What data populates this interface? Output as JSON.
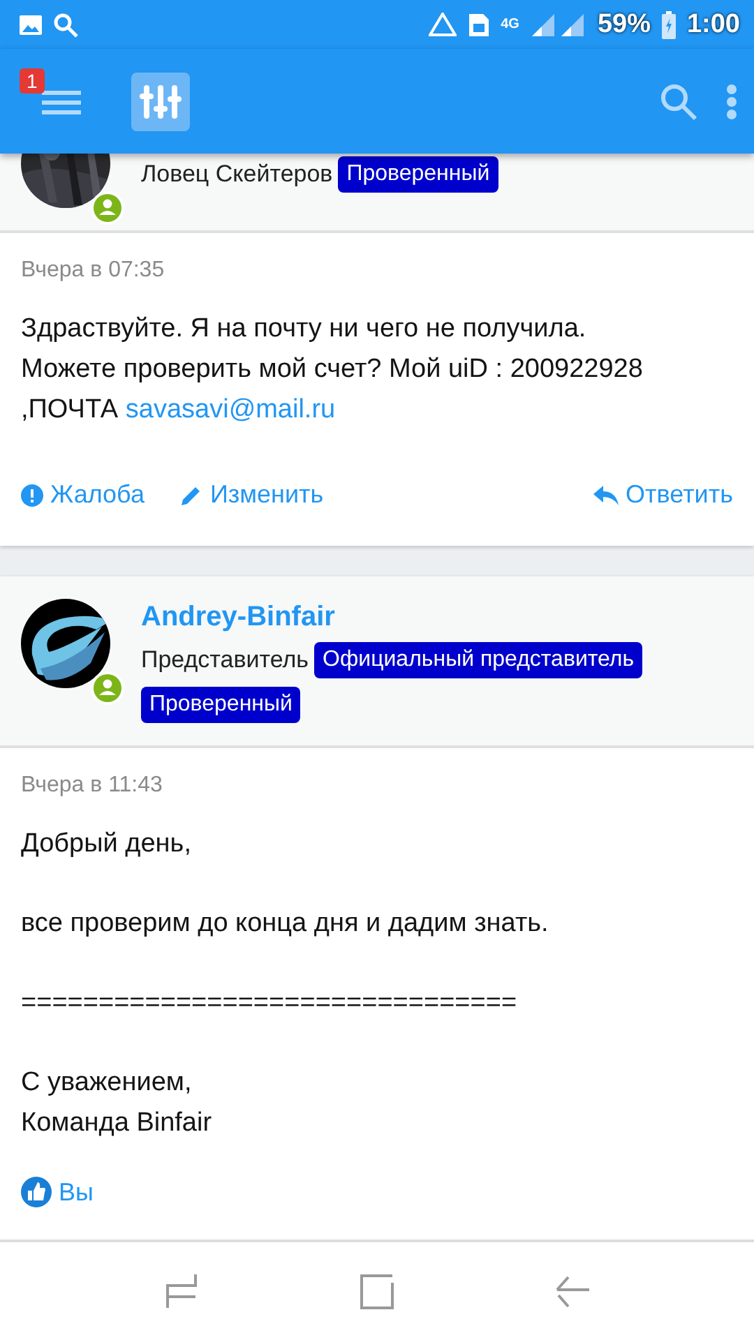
{
  "status_bar": {
    "network": "4G",
    "battery": "59%",
    "time": "1:00"
  },
  "app_bar": {
    "notification_count": "1"
  },
  "posts": [
    {
      "author": {
        "title": "Ловец Скейтеров",
        "badges": [
          "Проверенный"
        ],
        "avatar": {
          "kind": "picture"
        },
        "online": true
      },
      "time": "Вчера в 07:35",
      "paragraphs": [
        {
          "text": "Здраствуйте. Я на почту ни чего не получила.\nМожете проверить мой счет? Мой uiD : 200922928\n,ПОЧТА ",
          "link": "savasavi@mail.ru"
        }
      ],
      "actions": [
        {
          "kind": "report",
          "label": "Жалоба"
        },
        {
          "kind": "edit",
          "label": "Изменить"
        },
        {
          "kind": "reply",
          "label": "Ответить"
        }
      ]
    },
    {
      "author": {
        "name": "Andrey-Binfair",
        "title": "Представитель",
        "badges": [
          "Официальный представитель",
          "Проверенный"
        ],
        "avatar": {
          "kind": "logo"
        },
        "online": true
      },
      "time": "Вчера в 11:43",
      "paragraphs": [
        {
          "text": "Добрый день,"
        },
        {
          "text": "все проверим до конца дня и дадим знать."
        },
        {
          "text": "================================"
        },
        {
          "text": "С уважением,\nКоманда Binfair"
        }
      ],
      "reactions": [
        {
          "kind": "like",
          "label": "Вы"
        }
      ]
    }
  ]
}
